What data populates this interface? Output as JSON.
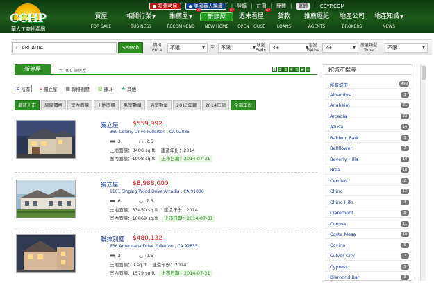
{
  "header": {
    "logo": {
      "brand": "CCHP",
      "subtitle": "華人工商地產網"
    },
    "top_links": {
      "btn_visa": "投資移民",
      "btn_forum": "美國華人論壇",
      "login": "登錄",
      "register": "註冊",
      "simplified": "簡體",
      "traditional": "繁體",
      "site": "CCYP.COM"
    },
    "nav": [
      {
        "zh": "買屋",
        "en": "FOR SALE"
      },
      {
        "zh": "相關行業",
        "en": "BUSINESS",
        "dropdown": true
      },
      {
        "zh": "推薦屋",
        "en": "RECOMMEND",
        "dropdown": true,
        "hot": "VIP"
      },
      {
        "zh": "新建屋",
        "en": "NEW HOME",
        "hot": "VIP"
      },
      {
        "zh": "週末看屋",
        "en": "OPEN HOUSE",
        "hot": "VIP"
      },
      {
        "zh": "貸款",
        "en": "LOANS"
      },
      {
        "zh": "推薦經紀",
        "en": "AGENTS"
      },
      {
        "zh": "地產公司",
        "en": "BROKERS"
      },
      {
        "zh": "地產知識",
        "en": "NEWS",
        "dropdown": true
      }
    ]
  },
  "search": {
    "value": "ARCADIA",
    "button": "Search",
    "price_label": "價格",
    "price_en": "Price",
    "price_min": "不限",
    "to": "至",
    "price_max": "不限",
    "beds_label": "臥室",
    "beds_en": "Beds",
    "beds_value": "3+",
    "baths_label": "浴室",
    "baths_en": "Baths",
    "baths_value": "2+",
    "type_label": "房屋類型",
    "type_en": "Type",
    "type_value": "不限"
  },
  "main": {
    "tab": "新建屋",
    "count": "共 499 筆房屋",
    "pages": [
      "1",
      "2",
      "3",
      "4",
      "5",
      "►",
      "»"
    ],
    "types": [
      "所有",
      "獨立屋",
      "聯排別墅",
      "康斗",
      "其他"
    ],
    "sorts": [
      "最新上市",
      "房屋價格",
      "室內面積",
      "土地面積",
      "臥室數量",
      "浴室數量",
      "2013年建",
      "2014年建",
      "全部年份"
    ]
  },
  "listings": [
    {
      "type": "獨立屋",
      "price": "$559,992",
      "address": "360 Colony Drive Fullerton , CA 92835",
      "beds": "3",
      "baths": "2.5",
      "land_label": "土地面積：",
      "land": "3400 sq.ft",
      "year_label": "建造年份：",
      "year": "2014",
      "interior_label": "室內面積：",
      "interior": "1908 sq.ft",
      "listed": "上市日期：2014-07-31"
    },
    {
      "type": "獨立屋",
      "price": "$8,988,000",
      "address": "1101 Singing Wood Drive Arcadia , CA 91006",
      "beds": "6",
      "baths": "7.5",
      "land_label": "土地面積：",
      "land": "33450 sq.ft",
      "year_label": "建造年份：",
      "year": "2014",
      "interior_label": "室內面積：",
      "interior": "10869 sq.ft",
      "listed": "上市日期：2014-07-31"
    },
    {
      "type": "聯排別墅",
      "price": "$480,132",
      "address": "656 Americana Drive Fullerton , CA 92835",
      "beds": "3",
      "baths": "2.5",
      "land_label": "土地面積：",
      "land": "0 sq.ft",
      "year_label": "建造年份：",
      "year": "2014",
      "interior_label": "室內面積：",
      "interior": "1579 sq.ft",
      "listed": "上市日期：2014-07-31"
    }
  ],
  "sidebar": {
    "title": "按城市搜尋",
    "cities": [
      {
        "name": "所有城市",
        "count": "499"
      },
      {
        "name": "Alhambra",
        "count": "3"
      },
      {
        "name": "Anaheim",
        "count": "21"
      },
      {
        "name": "Arcadia",
        "count": "22"
      },
      {
        "name": "Azusa",
        "count": "14"
      },
      {
        "name": "Baldwin Park",
        "count": "3"
      },
      {
        "name": "Bellflower",
        "count": "2"
      },
      {
        "name": "Beverly Hills",
        "count": "10"
      },
      {
        "name": "Brea",
        "count": "18"
      },
      {
        "name": "Cerritos",
        "count": "2"
      },
      {
        "name": "Chino",
        "count": "12"
      },
      {
        "name": "Chino Hills",
        "count": "4"
      },
      {
        "name": "Claremont",
        "count": "8"
      },
      {
        "name": "Corona",
        "count": "11"
      },
      {
        "name": "Costa Mesa",
        "count": "10"
      },
      {
        "name": "Covina",
        "count": "5"
      },
      {
        "name": "Culver City",
        "count": "3"
      },
      {
        "name": "Cypress",
        "count": "5"
      },
      {
        "name": "Diamond Bar",
        "count": "3"
      }
    ]
  },
  "colors": {
    "brand_green": "#2d8e24",
    "price_red": "#e01010",
    "link_blue": "#1a3d9c"
  }
}
